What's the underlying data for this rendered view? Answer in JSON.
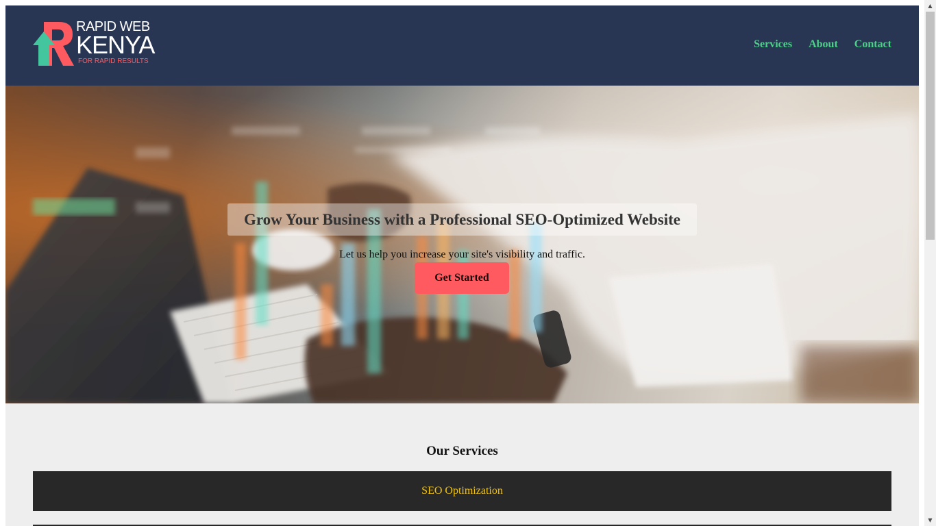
{
  "logo": {
    "line1": "RAPID WEB",
    "line2": "KENYA",
    "tagline": "FOR RAPID RESULTS"
  },
  "nav": {
    "items": [
      {
        "label": "Services"
      },
      {
        "label": "About"
      },
      {
        "label": "Contact"
      }
    ]
  },
  "hero": {
    "title": "Grow Your Business with a Professional SEO-Optimized Website",
    "subtitle": "Let us help you increase your site's visibility and traffic.",
    "cta_label": "Get Started"
  },
  "services": {
    "title": "Our Services",
    "items": [
      {
        "label": "SEO Optimization"
      }
    ]
  },
  "colors": {
    "header_bg": "#283654",
    "nav_link": "#4fd18b",
    "accent": "#ff5a5f",
    "service_text": "#f4c20d",
    "service_bg": "#282828"
  },
  "icons": {
    "scroll_up": "chevron-up-icon",
    "scroll_down": "chevron-down-icon"
  }
}
